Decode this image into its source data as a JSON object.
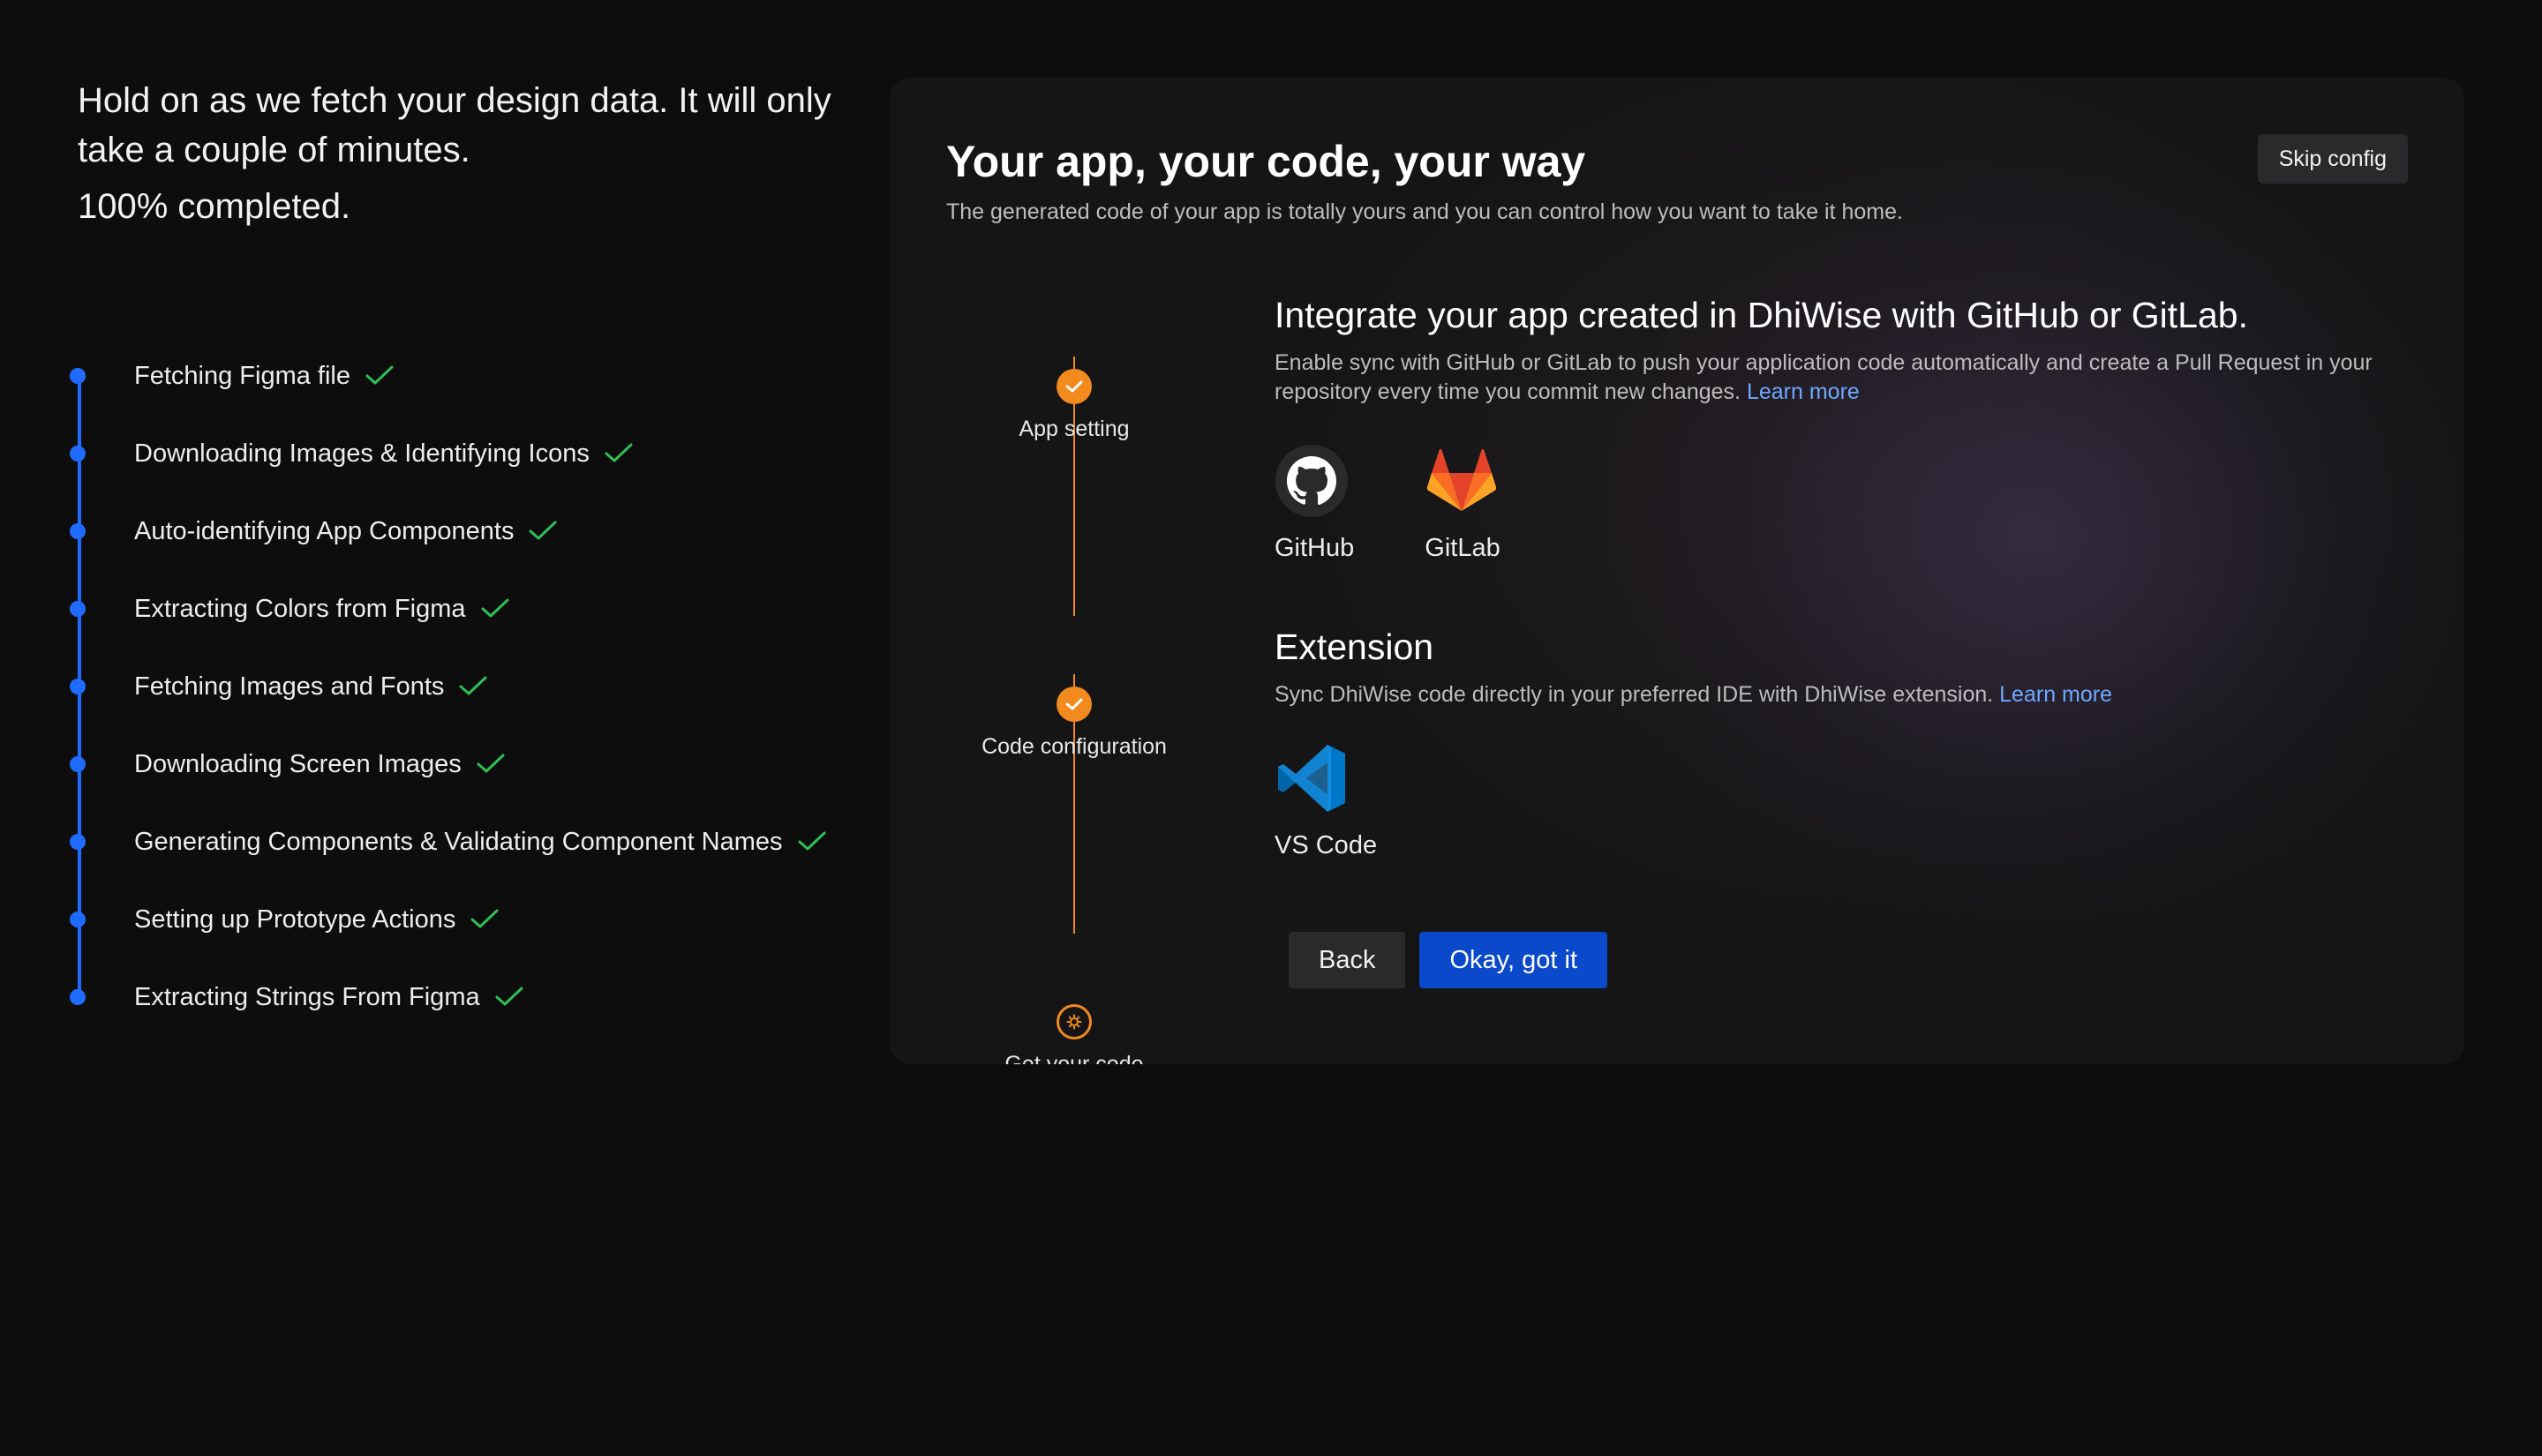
{
  "progress": {
    "message": "Hold on as we fetch your design data. It will only take a couple of minutes.",
    "percent_text": "100% completed.",
    "percent": 100,
    "accent_color": "#1f6bff",
    "check_color": "#2fbf52",
    "steps": [
      {
        "label": "Fetching Figma file",
        "done": true
      },
      {
        "label": "Downloading Images & Identifying Icons",
        "done": true
      },
      {
        "label": "Auto-identifying App Components",
        "done": true
      },
      {
        "label": "Extracting Colors from Figma",
        "done": true
      },
      {
        "label": "Fetching Images and Fonts",
        "done": true
      },
      {
        "label": "Downloading Screen Images",
        "done": true
      },
      {
        "label": "Generating Components & Validating Component Names",
        "done": true
      },
      {
        "label": "Setting up Prototype Actions",
        "done": true
      },
      {
        "label": "Extracting Strings From Figma",
        "done": true
      }
    ]
  },
  "card": {
    "title": "Your app, your code, your way",
    "subtitle": "The generated code of your app is totally yours and you can control how you want to take it home.",
    "skip_label": "Skip config",
    "stepper": [
      {
        "label": "App setting",
        "state": "done"
      },
      {
        "label": "Code configuration",
        "state": "done"
      },
      {
        "label": "Get your code",
        "state": "current"
      }
    ],
    "stepper_color": "#f28a1e",
    "integration": {
      "title": "Integrate your app created in DhiWise with GitHub or GitLab.",
      "description": "Enable sync with GitHub or GitLab to push your application code automatically and create a Pull Request in your repository every time you commit new changes.",
      "learn_more": "Learn more",
      "providers": [
        {
          "name": "GitHub",
          "icon": "github-icon"
        },
        {
          "name": "GitLab",
          "icon": "gitlab-icon"
        }
      ]
    },
    "extension": {
      "title": "Extension",
      "description": "Sync DhiWise code directly in your preferred IDE with DhiWise extension.",
      "learn_more": "Learn more",
      "providers": [
        {
          "name": "VS Code",
          "icon": "vscode-icon"
        }
      ]
    },
    "back_label": "Back",
    "ok_label": "Okay, got it"
  }
}
